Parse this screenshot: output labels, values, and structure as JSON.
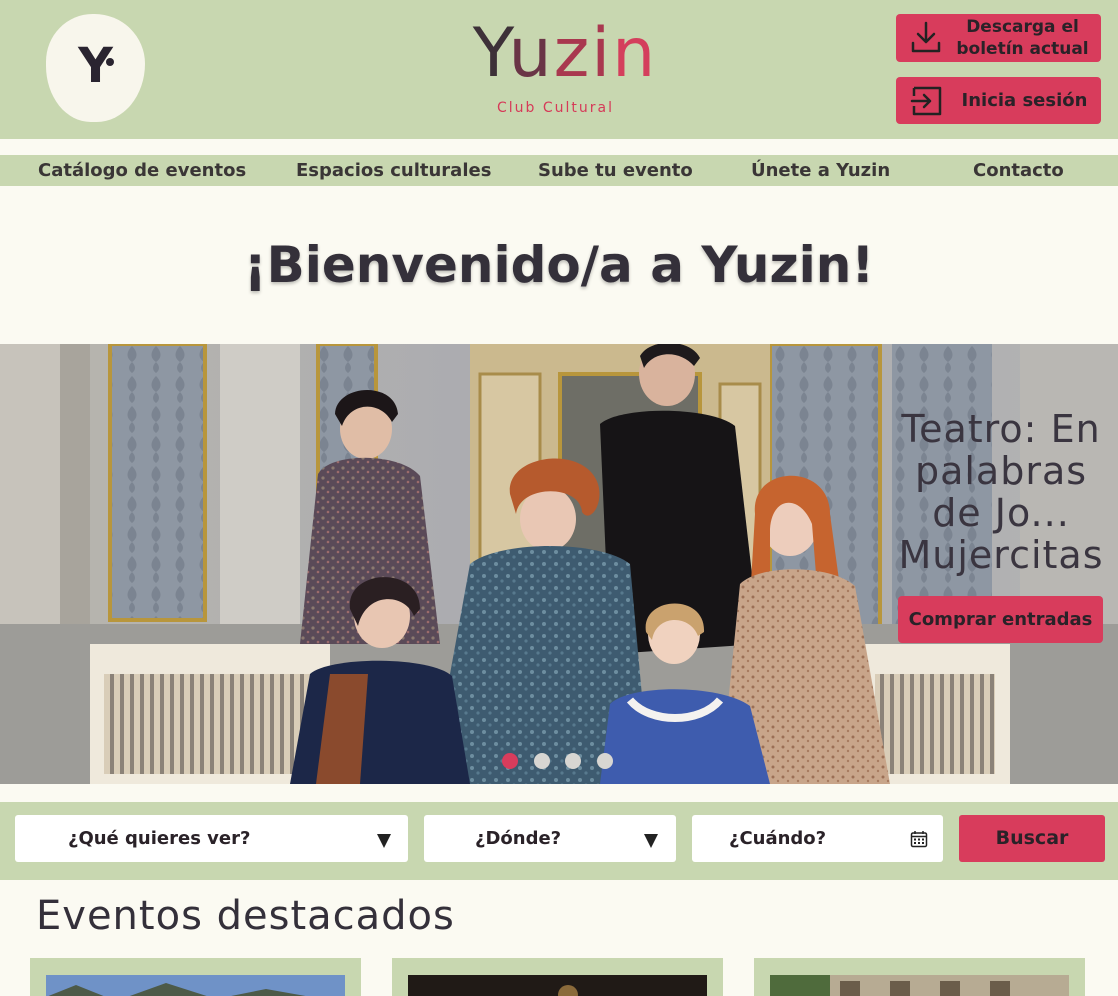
{
  "header": {
    "logo_letter": "Y",
    "brand_name": "Yuzin",
    "brand_tagline": "Club Cultural",
    "download_button_label": "Descarga el boletín actual",
    "download_line1": "Descarga el",
    "download_line2": "boletín actual",
    "login_button_label": "Inicia sesión"
  },
  "nav": {
    "items": [
      {
        "label": "Catálogo de eventos"
      },
      {
        "label": "Espacios culturales"
      },
      {
        "label": "Sube tu evento"
      },
      {
        "label": "Únete a Yuzin"
      },
      {
        "label": "Contacto"
      }
    ]
  },
  "welcome": {
    "title": "¡Bienvenido/a a Yuzin!"
  },
  "hero": {
    "title": "Teatro: En palabras de Jo... Mujercitas",
    "title_lines": [
      "Teatro: En",
      "palabras",
      "de Jo...",
      "Mujercitas"
    ],
    "cta_label": "Comprar entradas",
    "slide_count": 4,
    "active_slide": 1
  },
  "search": {
    "what_label": "¿Qué quieres ver?",
    "where_label": "¿Dónde?",
    "when_label": "¿Cuándo?",
    "submit_label": "Buscar"
  },
  "featured": {
    "title": "Eventos destacados",
    "card_count": 3
  },
  "colors": {
    "green": "#c8d7b0",
    "accent": "#d83c5c",
    "background": "#fbfaf2",
    "text": "#34303a"
  }
}
